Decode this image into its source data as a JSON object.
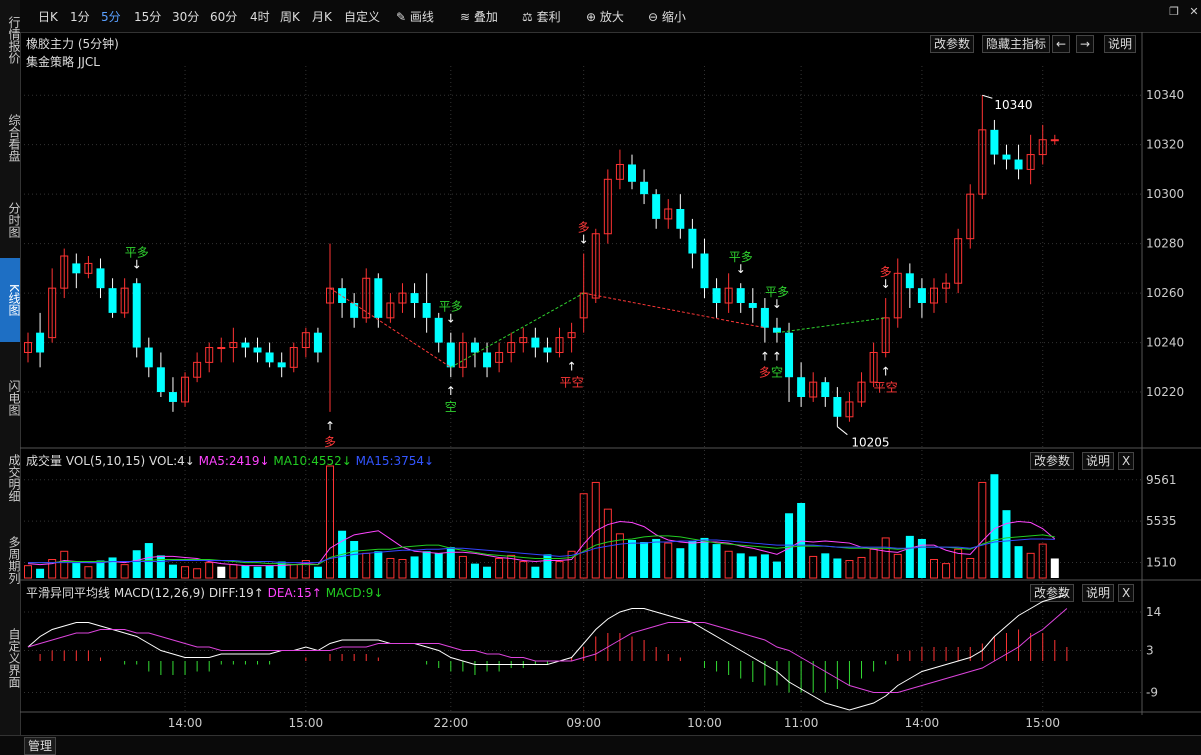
{
  "sidebar": [
    "行情报价",
    "综合看盘",
    "分时图",
    "K线图",
    "闪电图",
    "成交明细",
    "多周期列",
    "自定义界面"
  ],
  "sidebar_active": 3,
  "toolbar": {
    "periods": [
      "日K",
      "1分",
      "5分",
      "15分",
      "30分",
      "60分",
      "4时",
      "周K",
      "月K",
      "自定义"
    ],
    "active_period": 2,
    "tools": [
      "画线",
      "叠加",
      "套利",
      "放大",
      "缩小"
    ],
    "tool_icons": [
      "pen-icon",
      "stack-icon",
      "arbitrage-icon",
      "zoom-in-icon",
      "zoom-out-icon"
    ]
  },
  "main_panel": {
    "title": "橡胶主力 (5分钟)",
    "strategy": "集金策略 JJCL",
    "buttons": [
      "改参数",
      "隐藏主指标",
      "←",
      "→",
      "说明"
    ],
    "high_label": "10340",
    "low_label": "10205"
  },
  "volume_panel": {
    "label": "成交量",
    "indicator": "VOL(5,10,15)",
    "vol": "VOL:4↓",
    "ma5": "MA5:2419↓",
    "ma10": "MA10:4552↓",
    "ma15": "MA15:3754↓",
    "buttons": [
      "改参数",
      "说明",
      "X"
    ]
  },
  "macd_panel": {
    "label": "平滑异同平均线",
    "indicator": "MACD(12,26,9)",
    "diff": "DIFF:19↑",
    "dea": "DEA:15↑",
    "macd": "MACD:9↓",
    "buttons": [
      "改参数",
      "说明",
      "X"
    ]
  },
  "signals": [
    {
      "text": "平多",
      "color": "#2fd22f",
      "i": 9,
      "pos": "above"
    },
    {
      "text": "多",
      "color": "#ff3838",
      "i": 25,
      "pos": "below"
    },
    {
      "text": "平多",
      "color": "#2fd22f",
      "i": 35,
      "pos": "above"
    },
    {
      "text": "空",
      "color": "#2fd22f",
      "i": 35,
      "pos": "below"
    },
    {
      "text": "平空",
      "color": "#ff3838",
      "i": 45,
      "pos": "below"
    },
    {
      "text": "多",
      "color": "#ff3838",
      "i": 46,
      "pos": "above"
    },
    {
      "text": "平多",
      "color": "#2fd22f",
      "i": 59,
      "pos": "above"
    },
    {
      "text": "多",
      "color": "#ff3838",
      "i": 61,
      "pos": "below"
    },
    {
      "text": "平多",
      "color": "#2fd22f",
      "i": 62,
      "pos": "above"
    },
    {
      "text": "空",
      "color": "#2fd22f",
      "i": 62,
      "pos": "below"
    },
    {
      "text": "多",
      "color": "#ff3838",
      "i": 71,
      "pos": "above"
    },
    {
      "text": "平空",
      "color": "#ff3838",
      "i": 71,
      "pos": "below"
    }
  ],
  "colors": {
    "up": "#ff3333",
    "down": "#00ffff",
    "bg": "#000000",
    "grid": "#333333",
    "diff": "#ffffff",
    "dea": "#dd44dd",
    "ma5": "#ff44ff",
    "ma10": "#22cc22",
    "ma15": "#3344ff"
  },
  "status": {
    "tab": "管理"
  },
  "chart_data": {
    "type": "candlestick",
    "x_ticks": [
      "14:00",
      "15:00",
      "22:00",
      "09:00",
      "10:00",
      "11:00",
      "14:00",
      "15:00"
    ],
    "x_tick_index": [
      13,
      23,
      35,
      46,
      56,
      64,
      74,
      84
    ],
    "price_axis": {
      "ticks": [
        10220,
        10240,
        10260,
        10280,
        10300,
        10320,
        10340
      ],
      "range": [
        10199,
        10351
      ]
    },
    "volume_axis": {
      "ticks": [
        1510,
        5535,
        9561
      ],
      "range": [
        0,
        10900
      ]
    },
    "macd_axis": {
      "ticks": [
        -9,
        3,
        14
      ],
      "range": [
        -14,
        18
      ]
    },
    "candles": [
      [
        10236,
        10240,
        10232,
        10244
      ],
      [
        10244,
        10236,
        10230,
        10252
      ],
      [
        10242,
        10262,
        10240,
        10270
      ],
      [
        10262,
        10275,
        10258,
        10278
      ],
      [
        10272,
        10268,
        10262,
        10276
      ],
      [
        10268,
        10272,
        10266,
        10275
      ],
      [
        10270,
        10262,
        10258,
        10274
      ],
      [
        10262,
        10252,
        10250,
        10266
      ],
      [
        10252,
        10262,
        10250,
        10266
      ],
      [
        10264,
        10238,
        10234,
        10266
      ],
      [
        10238,
        10230,
        10226,
        10242
      ],
      [
        10230,
        10220,
        10218,
        10236
      ],
      [
        10220,
        10216,
        10212,
        10226
      ],
      [
        10216,
        10226,
        10214,
        10228
      ],
      [
        10226,
        10232,
        10224,
        10236
      ],
      [
        10232,
        10238,
        10228,
        10240
      ],
      [
        10238,
        10238,
        10232,
        10242
      ],
      [
        10238,
        10240,
        10232,
        10246
      ],
      [
        10240,
        10238,
        10234,
        10242
      ],
      [
        10238,
        10236,
        10232,
        10242
      ],
      [
        10236,
        10232,
        10230,
        10240
      ],
      [
        10232,
        10230,
        10226,
        10236
      ],
      [
        10230,
        10238,
        10228,
        10240
      ],
      [
        10238,
        10244,
        10234,
        10246
      ],
      [
        10244,
        10236,
        10232,
        10246
      ],
      [
        10256,
        10262,
        10212,
        10280
      ],
      [
        10262,
        10256,
        10250,
        10266
      ],
      [
        10256,
        10250,
        10246,
        10260
      ],
      [
        10250,
        10266,
        10248,
        10270
      ],
      [
        10266,
        10250,
        10246,
        10268
      ],
      [
        10250,
        10256,
        10248,
        10260
      ],
      [
        10256,
        10260,
        10252,
        10264
      ],
      [
        10260,
        10256,
        10250,
        10264
      ],
      [
        10256,
        10250,
        10244,
        10268
      ],
      [
        10250,
        10240,
        10236,
        10252
      ],
      [
        10240,
        10230,
        10226,
        10244
      ],
      [
        10230,
        10240,
        10226,
        10244
      ],
      [
        10240,
        10236,
        10230,
        10242
      ],
      [
        10236,
        10230,
        10226,
        10240
      ],
      [
        10232,
        10236,
        10228,
        10240
      ],
      [
        10236,
        10240,
        10232,
        10244
      ],
      [
        10240,
        10242,
        10236,
        10246
      ],
      [
        10242,
        10238,
        10234,
        10246
      ],
      [
        10238,
        10236,
        10232,
        10242
      ],
      [
        10236,
        10242,
        10234,
        10246
      ],
      [
        10242,
        10244,
        10236,
        10248
      ],
      [
        10250,
        10260,
        10244,
        10276
      ],
      [
        10258,
        10284,
        10256,
        10286
      ],
      [
        10284,
        10306,
        10280,
        10310
      ],
      [
        10306,
        10312,
        10302,
        10318
      ],
      [
        10312,
        10305,
        10302,
        10316
      ],
      [
        10305,
        10300,
        10296,
        10310
      ],
      [
        10300,
        10290,
        10286,
        10302
      ],
      [
        10290,
        10294,
        10286,
        10298
      ],
      [
        10294,
        10286,
        10282,
        10300
      ],
      [
        10286,
        10276,
        10270,
        10290
      ],
      [
        10276,
        10262,
        10258,
        10282
      ],
      [
        10262,
        10256,
        10250,
        10266
      ],
      [
        10256,
        10262,
        10252,
        10268
      ],
      [
        10262,
        10256,
        10252,
        10264
      ],
      [
        10256,
        10254,
        10248,
        10262
      ],
      [
        10254,
        10246,
        10240,
        10258
      ],
      [
        10246,
        10244,
        10240,
        10250
      ],
      [
        10244,
        10226,
        10216,
        10248
      ],
      [
        10226,
        10218,
        10214,
        10232
      ],
      [
        10218,
        10224,
        10216,
        10228
      ],
      [
        10224,
        10218,
        10214,
        10226
      ],
      [
        10218,
        10210,
        10206,
        10222
      ],
      [
        10210,
        10216,
        10208,
        10220
      ],
      [
        10216,
        10224,
        10214,
        10228
      ],
      [
        10224,
        10236,
        10222,
        10240
      ],
      [
        10236,
        10250,
        10234,
        10258
      ],
      [
        10250,
        10268,
        10246,
        10274
      ],
      [
        10268,
        10262,
        10254,
        10272
      ],
      [
        10262,
        10256,
        10250,
        10266
      ],
      [
        10256,
        10262,
        10252,
        10266
      ],
      [
        10262,
        10264,
        10256,
        10268
      ],
      [
        10264,
        10282,
        10260,
        10286
      ],
      [
        10282,
        10300,
        10278,
        10304
      ],
      [
        10300,
        10326,
        10298,
        10340
      ],
      [
        10326,
        10316,
        10312,
        10330
      ],
      [
        10316,
        10314,
        10310,
        10320
      ],
      [
        10314,
        10310,
        10306,
        10320
      ],
      [
        10310,
        10316,
        10304,
        10324
      ],
      [
        10316,
        10322,
        10312,
        10328
      ],
      [
        10322,
        10322,
        10320,
        10324
      ]
    ],
    "volume": [
      1200,
      900,
      1800,
      2600,
      1500,
      1100,
      1700,
      2000,
      1300,
      2700,
      3400,
      2200,
      1300,
      1100,
      900,
      1500,
      1100,
      1300,
      1200,
      1100,
      1200,
      1600,
      1300,
      1700,
      1100,
      10900,
      4600,
      3600,
      2400,
      2600,
      1900,
      1800,
      2100,
      2600,
      2400,
      3000,
      2100,
      1400,
      1100,
      1900,
      2200,
      1600,
      1100,
      2300,
      1600,
      2600,
      8200,
      9300,
      6700,
      4300,
      3700,
      3500,
      3800,
      3400,
      2900,
      3600,
      3900,
      3300,
      2600,
      2400,
      2100,
      2300,
      1600,
      6300,
      7300,
      2100,
      2400,
      1900,
      1700,
      2000,
      2800,
      3900,
      2300,
      4100,
      3800,
      1800,
      1400,
      2800,
      1900,
      9300,
      10100,
      6600,
      3100,
      2400,
      3300,
      1900
    ],
    "ma5": [
      1400,
      1300,
      1400,
      1700,
      1600,
      1500,
      1500,
      1600,
      1500,
      1700,
      2000,
      2100,
      2100,
      2000,
      1900,
      1600,
      1400,
      1300,
      1200,
      1200,
      1200,
      1200,
      1300,
      1400,
      1300,
      2900,
      3600,
      4200,
      4400,
      4600,
      3800,
      3000,
      2600,
      2500,
      2400,
      2500,
      2500,
      2400,
      2200,
      2000,
      1900,
      1700,
      1600,
      1700,
      1700,
      1800,
      3300,
      4600,
      5200,
      5500,
      5400,
      5000,
      4200,
      3700,
      3500,
      3400,
      3500,
      3500,
      3400,
      3100,
      2900,
      2600,
      2300,
      2900,
      3600,
      3500,
      3600,
      3500,
      3400,
      3000,
      2800,
      2600,
      2500,
      2900,
      3200,
      3200,
      2700,
      2400,
      2300,
      3600,
      4800,
      5300,
      5500,
      5400,
      4800,
      3800
    ],
    "ma10": [
      1500,
      1500,
      1500,
      1600,
      1600,
      1600,
      1600,
      1600,
      1600,
      1600,
      1700,
      1800,
      1800,
      1800,
      1800,
      1800,
      1700,
      1600,
      1500,
      1500,
      1400,
      1400,
      1300,
      1300,
      1300,
      2000,
      2300,
      2600,
      2700,
      2800,
      2800,
      3000,
      3100,
      3200,
      3200,
      2900,
      2700,
      2500,
      2300,
      2200,
      2100,
      2000,
      1900,
      1900,
      1900,
      2000,
      2600,
      3200,
      3500,
      3700,
      3800,
      4000,
      4100,
      4100,
      4000,
      3800,
      3600,
      3400,
      3300,
      3200,
      3100,
      3000,
      2900,
      3000,
      3100,
      3100,
      3100,
      3000,
      2900,
      2900,
      2900,
      2900,
      2800,
      2900,
      3000,
      3000,
      3000,
      2900,
      2800,
      3300,
      3700,
      3900,
      4000,
      4100,
      4200,
      4000
    ],
    "ma15": [
      1500,
      1500,
      1500,
      1500,
      1500,
      1500,
      1500,
      1600,
      1600,
      1600,
      1600,
      1600,
      1700,
      1700,
      1700,
      1700,
      1700,
      1700,
      1600,
      1600,
      1600,
      1500,
      1500,
      1500,
      1500,
      1900,
      2100,
      2300,
      2400,
      2500,
      2600,
      2700,
      2700,
      2800,
      2800,
      2900,
      2900,
      2800,
      2700,
      2600,
      2500,
      2400,
      2300,
      2200,
      2100,
      2200,
      2500,
      2900,
      3100,
      3300,
      3400,
      3400,
      3500,
      3500,
      3600,
      3600,
      3700,
      3700,
      3600,
      3500,
      3400,
      3300,
      3200,
      3200,
      3200,
      3200,
      3100,
      3000,
      3000,
      3000,
      3000,
      3000,
      2900,
      2900,
      3000,
      3000,
      3000,
      3000,
      2900,
      3200,
      3500,
      3600,
      3700,
      3800,
      3800,
      3754
    ],
    "diff": [
      4,
      7,
      9,
      10,
      11,
      11,
      10,
      9,
      8,
      7,
      5,
      3,
      2,
      1,
      1,
      1,
      2,
      2,
      2,
      2,
      2,
      3,
      3,
      4,
      3,
      5,
      6,
      6,
      6,
      6,
      5,
      5,
      5,
      4,
      3,
      1,
      0,
      -1,
      -1,
      -1,
      -1,
      -1,
      -1,
      -1,
      0,
      1,
      5,
      9,
      12,
      14,
      15,
      15,
      14,
      13,
      12,
      11,
      9,
      7,
      5,
      3,
      1,
      -1,
      -3,
      -6,
      -8,
      -10,
      -12,
      -13,
      -14,
      -13,
      -12,
      -10,
      -7,
      -5,
      -3,
      -2,
      -1,
      0,
      1,
      3,
      7,
      10,
      13,
      15,
      17,
      18,
      19
    ],
    "dea": [
      4,
      5,
      6,
      7,
      8,
      8,
      9,
      9,
      9,
      8,
      8,
      7,
      6,
      5,
      4,
      4,
      3,
      3,
      3,
      3,
      3,
      3,
      3,
      3,
      3,
      3,
      4,
      4,
      4,
      5,
      5,
      5,
      5,
      5,
      5,
      4,
      3,
      3,
      2,
      2,
      1,
      1,
      0,
      0,
      0,
      0,
      1,
      2,
      4,
      6,
      8,
      9,
      10,
      11,
      11,
      11,
      11,
      10,
      9,
      8,
      7,
      6,
      4,
      3,
      1,
      -1,
      -3,
      -5,
      -7,
      -8,
      -9,
      -9,
      -9,
      -8,
      -7,
      -6,
      -5,
      -4,
      -3,
      -2,
      0,
      2,
      4,
      7,
      9,
      12,
      15
    ],
    "macd": [
      0,
      2,
      3,
      3,
      3,
      3,
      1,
      0,
      -1,
      -1,
      -3,
      -4,
      -4,
      -4,
      -3,
      -3,
      -1,
      -1,
      -1,
      -1,
      -1,
      0,
      0,
      1,
      0,
      2,
      2,
      2,
      2,
      1,
      0,
      0,
      0,
      -1,
      -2,
      -3,
      -3,
      -4,
      -3,
      -3,
      -2,
      -2,
      -1,
      -1,
      0,
      1,
      4,
      7,
      8,
      8,
      7,
      6,
      4,
      2,
      1,
      0,
      -2,
      -3,
      -4,
      -5,
      -6,
      -7,
      -7,
      -9,
      -9,
      -9,
      -9,
      -8,
      -7,
      -5,
      -3,
      -1,
      2,
      3,
      4,
      4,
      4,
      4,
      4,
      5,
      7,
      8,
      9,
      8,
      8,
      6,
      4
    ]
  }
}
